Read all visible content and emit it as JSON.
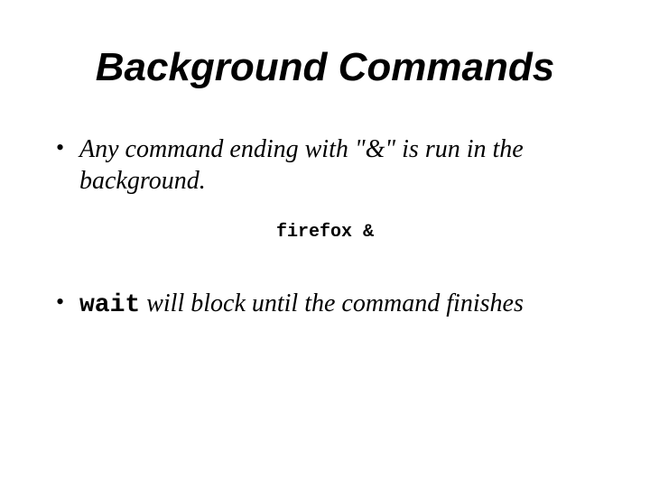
{
  "title": "Background Commands",
  "bullet1": "Any command ending with \"&\" is run in the background.",
  "code_example": "firefox &",
  "bullet2_cmd": "wait",
  "bullet2_rest": " will block until the command finishes"
}
